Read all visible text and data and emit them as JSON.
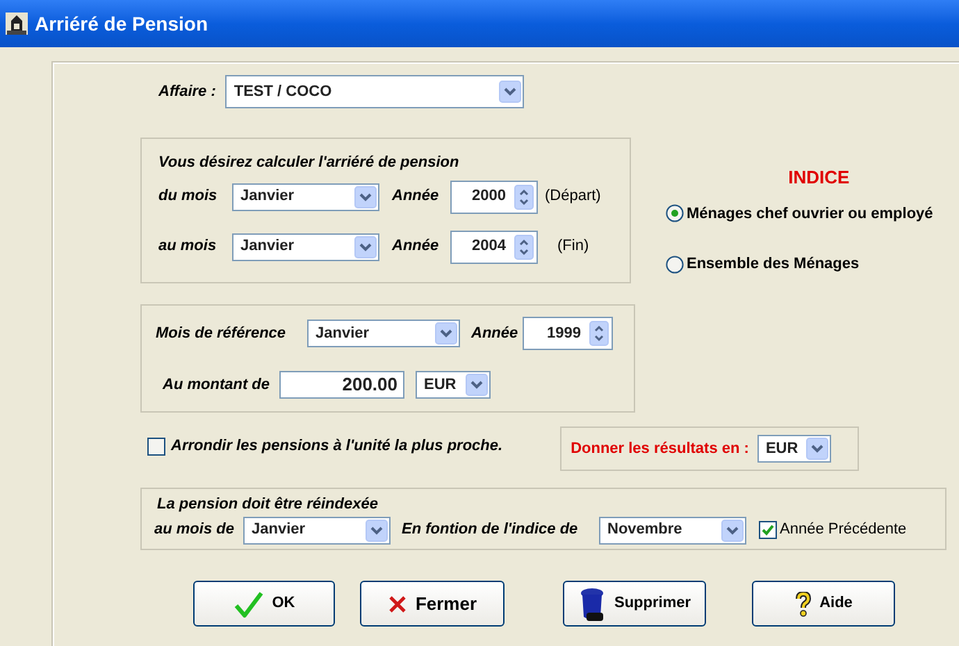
{
  "window": {
    "title": "Arriéré de Pension"
  },
  "affaire": {
    "label": "Affaire :",
    "value": "TEST / COCO"
  },
  "period": {
    "title": "Vous désirez calculer l'arriéré de pension",
    "rows": [
      {
        "label": "du mois",
        "month": "Janvier",
        "year_label": "Année",
        "year": "2000",
        "note": "(Départ)"
      },
      {
        "label": "au mois",
        "month": "Janvier",
        "year_label": "Année",
        "year": "2004",
        "note": "(Fin)"
      }
    ]
  },
  "reference": {
    "label": "Mois de référence",
    "month": "Janvier",
    "year_label": "Année",
    "year": "1999",
    "amount_label": "Au montant de",
    "amount": "200.00",
    "currency": "EUR"
  },
  "indice": {
    "title": "INDICE",
    "options": [
      {
        "label": "Ménages chef ouvrier ou employé",
        "selected": true
      },
      {
        "label": "Ensemble des Ménages",
        "selected": false
      }
    ]
  },
  "rounding": {
    "label": "Arrondir les pensions à l'unité la plus proche.",
    "checked": false
  },
  "results": {
    "label": "Donner les résultats en :",
    "currency": "EUR"
  },
  "reindex": {
    "title": "La pension doit être réindexée",
    "month_label": "au mois de",
    "month": "Janvier",
    "index_label": "En fontion de l'indice de",
    "index_month": "Novembre",
    "previous_year": {
      "label": "Année Précédente",
      "checked": true
    }
  },
  "buttons": [
    {
      "label": "OK",
      "kind": "ok"
    },
    {
      "label": "Fermer",
      "kind": "close"
    },
    {
      "label": "Supprimer",
      "kind": "delete"
    },
    {
      "label": "Aide",
      "kind": "help"
    }
  ]
}
